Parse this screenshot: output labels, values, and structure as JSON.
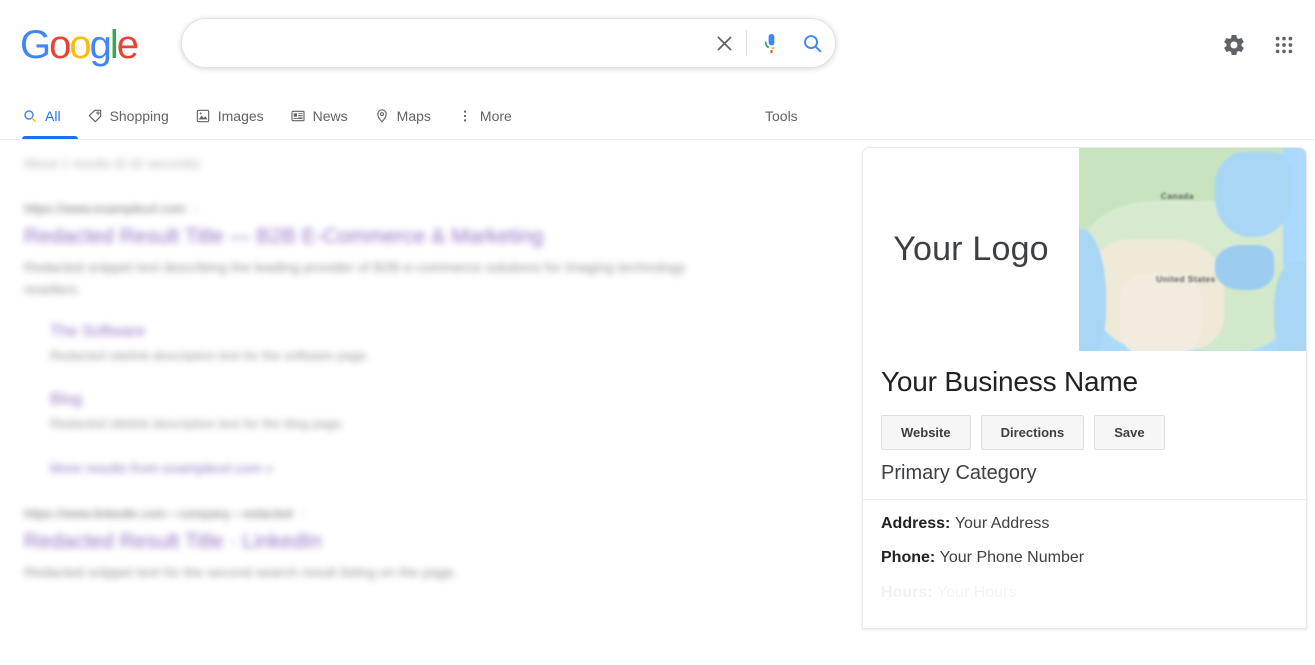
{
  "brand": {
    "name": "Google",
    "letters": [
      {
        "ch": "G",
        "color": "#4285F4"
      },
      {
        "ch": "o",
        "color": "#EA4335"
      },
      {
        "ch": "o",
        "color": "#FBBC05"
      },
      {
        "ch": "g",
        "color": "#4285F4"
      },
      {
        "ch": "l",
        "color": "#34A853"
      },
      {
        "ch": "e",
        "color": "#EA4335"
      }
    ]
  },
  "search": {
    "query": "",
    "placeholder": "",
    "clear_icon": "close-x-icon",
    "mic_icon": "microphone-icon",
    "search_icon": "magnifier-icon"
  },
  "header": {
    "settings_icon": "gear-icon",
    "apps_icon": "apps-grid-icon"
  },
  "nav": {
    "tabs": [
      {
        "label": "All",
        "icon": "magnifier-icon",
        "active": true
      },
      {
        "label": "Shopping",
        "icon": "tag-icon",
        "active": false
      },
      {
        "label": "Images",
        "icon": "image-icon",
        "active": false
      },
      {
        "label": "News",
        "icon": "newspaper-icon",
        "active": false
      },
      {
        "label": "Maps",
        "icon": "map-pin-icon",
        "active": false
      },
      {
        "label": "More",
        "icon": "kebab-menu-icon",
        "active": false
      }
    ],
    "tools_label": "Tools"
  },
  "results": {
    "stats": "About 1 results (0.42 seconds)",
    "items": [
      {
        "url": "https://www.exampleurl.com",
        "title": "Redacted Result Title — B2B E-Commerce & Marketing",
        "snippet": "Redacted snippet text describing the leading provider of B2B e-commerce solutions for imaging technology resellers.",
        "sitelinks": [
          {
            "title": "The Software",
            "desc": "Redacted sitelink description text for the software page."
          },
          {
            "title": "Blog",
            "desc": "Redacted sitelink description text for the blog page."
          }
        ],
        "more_link": "More results from exampleurl.com »"
      },
      {
        "url": "https://www.linkedin.com › company › redacted",
        "title": "Redacted Result Title · LinkedIn",
        "snippet": "Redacted snippet text for the second search result listing on the page."
      }
    ]
  },
  "knowledge_panel": {
    "logo_placeholder": "Your Logo",
    "map": {
      "icon": "map-thumbnail",
      "labels": [
        "Canada",
        "United States"
      ]
    },
    "business_name": "Your Business Name",
    "actions": [
      {
        "label": "Website"
      },
      {
        "label": "Directions"
      },
      {
        "label": "Save"
      }
    ],
    "category": "Primary Category",
    "facts": [
      {
        "label": "Address:",
        "value": "Your Address"
      },
      {
        "label": "Phone:",
        "value": "Your Phone Number"
      },
      {
        "label": "Hours:",
        "value": "Your Hours"
      }
    ]
  }
}
